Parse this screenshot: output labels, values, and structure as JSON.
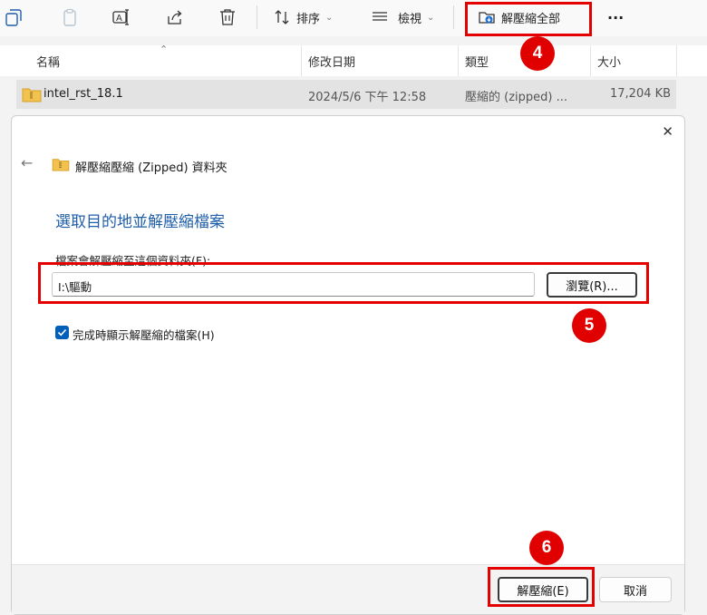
{
  "toolbar": {
    "sort_label": "排序",
    "view_label": "檢視",
    "extract_all_label": "解壓縮全部",
    "more_label": "···"
  },
  "columns": {
    "name": "名稱",
    "modified": "修改日期",
    "type": "類型",
    "size": "大小"
  },
  "file": {
    "name": "intel_rst_18.1",
    "modified": "2024/5/6 下午 12:58",
    "type": "壓縮的 (zipped) ...",
    "size": "17,204 KB"
  },
  "dialog": {
    "close_label": "✕",
    "nav_title": "解壓縮壓縮 (Zipped) 資料夾",
    "heading": "選取目的地並解壓縮檔案",
    "path_label": "檔案會解壓縮至這個資料夾(F):",
    "path_value": "I:\\驅動",
    "browse_label": "瀏覽(R)...",
    "show_files_label": "完成時顯示解壓縮的檔案(H)",
    "show_files_checked": true,
    "extract_label": "解壓縮(E)",
    "cancel_label": "取消"
  },
  "annotations": {
    "step4": "4",
    "step5": "5",
    "step6": "6"
  },
  "colors": {
    "highlight": "#e50000",
    "accent": "#005fb8",
    "heading": "#1f5ea8"
  }
}
